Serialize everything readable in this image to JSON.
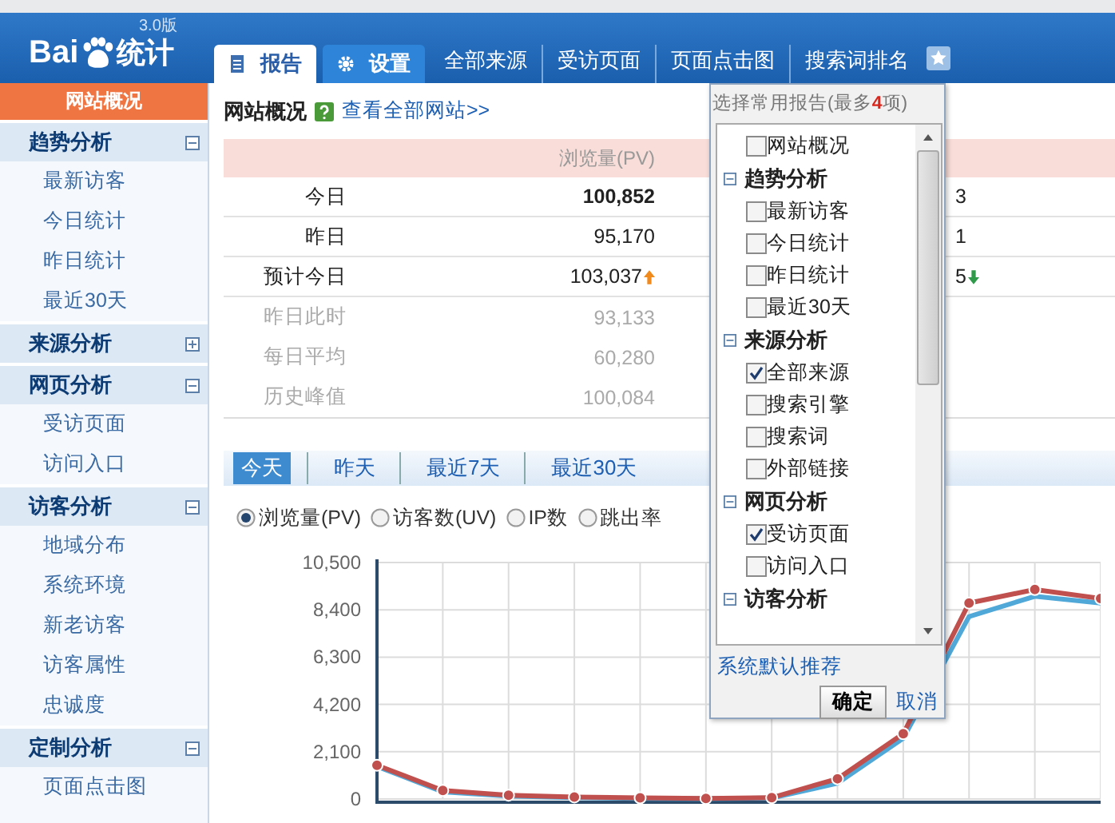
{
  "header": {
    "logo": {
      "brand": "Bai",
      "product": "统计",
      "version": "3.0版"
    },
    "tabs": [
      {
        "label": "报告",
        "selected": true
      },
      {
        "label": "设置",
        "selected": false
      }
    ],
    "links": [
      "全部来源",
      "受访页面",
      "页面点击图",
      "搜索词排名"
    ]
  },
  "sidebar": {
    "top": {
      "label": "网站概况",
      "selected": true
    },
    "groups": [
      {
        "label": "趋势分析",
        "expanded": true,
        "children": [
          "最新访客",
          "今日统计",
          "昨日统计",
          "最近30天"
        ]
      },
      {
        "label": "来源分析",
        "expanded": false
      },
      {
        "label": "网页分析",
        "expanded": true,
        "children": [
          "受访页面",
          "访问入口"
        ]
      },
      {
        "label": "访客分析",
        "expanded": true,
        "children": [
          "地域分布",
          "系统环境",
          "新老访客",
          "访客属性",
          "忠诚度"
        ]
      },
      {
        "label": "定制分析",
        "expanded": true,
        "children": [
          "页面点击图"
        ]
      }
    ]
  },
  "main": {
    "title": "网站概况",
    "link": "查看全部网站>>",
    "table": {
      "columns": [
        "浏览量(PV)"
      ],
      "rows": [
        {
          "label": "今日",
          "value": "100,852",
          "kind": "strong",
          "arrow": false,
          "column_2": "3",
          "arrow_2": false
        },
        {
          "label": "昨日",
          "value": "95,170",
          "kind": "normal",
          "arrow": false,
          "column_2": "1",
          "arrow_2": false
        },
        {
          "label": "预计今日",
          "value": "103,037",
          "kind": "normal",
          "arrow": true,
          "column_2": "5",
          "arrow_2": true
        },
        {
          "label": "昨日此时",
          "value": "93,133",
          "kind": "muted",
          "arrow": false,
          "arrow_2": false
        },
        {
          "label": "每日平均",
          "value": "60,280",
          "kind": "muted",
          "arrow": false,
          "arrow_2": false
        },
        {
          "label": "历史峰值",
          "value": "100,084",
          "kind": "muted",
          "arrow": false,
          "arrow_2": false
        }
      ]
    },
    "periods": [
      {
        "label": "今天",
        "selected": true
      },
      {
        "label": "昨天",
        "selected": false
      },
      {
        "label": "最近7天",
        "selected": false
      },
      {
        "label": "最近30天",
        "selected": false
      }
    ],
    "metrics": [
      {
        "label": "浏览量(PV)",
        "selected": true
      },
      {
        "label": "访客数(UV)",
        "selected": false
      },
      {
        "label": "IP数",
        "selected": false
      },
      {
        "label": "跳出率",
        "selected": false
      }
    ],
    "chart_data": {
      "type": "line",
      "grid": true,
      "ylim": [
        0,
        10500
      ],
      "yticks": [
        {
          "value": 0,
          "label": "0"
        },
        {
          "value": 2100,
          "label": "2,100"
        },
        {
          "value": 4200,
          "label": "4,200"
        },
        {
          "value": 6300,
          "label": "6,300"
        },
        {
          "value": 8400,
          "label": "8,400"
        },
        {
          "value": 10500,
          "label": "10,500"
        }
      ],
      "series": [
        {
          "color": "#4fa8d8",
          "marker": false,
          "values": [
            1450,
            320,
            130,
            60,
            30,
            20,
            40,
            700,
            2700,
            8100,
            9000,
            8700
          ]
        },
        {
          "color": "#c0504d",
          "marker": true,
          "values": [
            1500,
            380,
            170,
            90,
            50,
            30,
            60,
            900,
            2900,
            8700,
            9300,
            8900
          ]
        }
      ]
    }
  },
  "popup": {
    "title_start": "选择常用报告(最多",
    "title_count": "4",
    "title_end": "项)",
    "items": [
      {
        "kind": "item",
        "label": "网站概况",
        "checked": false
      },
      {
        "kind": "group",
        "label": "趋势分析",
        "expanded": true
      },
      {
        "kind": "item",
        "label": "最新访客",
        "checked": false
      },
      {
        "kind": "item",
        "label": "今日统计",
        "checked": false
      },
      {
        "kind": "item",
        "label": "昨日统计",
        "checked": false
      },
      {
        "kind": "item",
        "label": "最近30天",
        "checked": false
      },
      {
        "kind": "group",
        "label": "来源分析",
        "expanded": true
      },
      {
        "kind": "item",
        "label": "全部来源",
        "checked": true
      },
      {
        "kind": "item",
        "label": "搜索引擎",
        "checked": false
      },
      {
        "kind": "item",
        "label": "搜索词",
        "checked": false
      },
      {
        "kind": "item",
        "label": "外部链接",
        "checked": false
      },
      {
        "kind": "group",
        "label": "网页分析",
        "expanded": true
      },
      {
        "kind": "item",
        "label": "受访页面",
        "checked": true
      },
      {
        "kind": "item",
        "label": "访问入口",
        "checked": false
      },
      {
        "kind": "group",
        "label": "访客分析",
        "expanded": true
      }
    ],
    "default_link": "系统默认推荐",
    "ok": "确定",
    "cancel": "取消"
  }
}
